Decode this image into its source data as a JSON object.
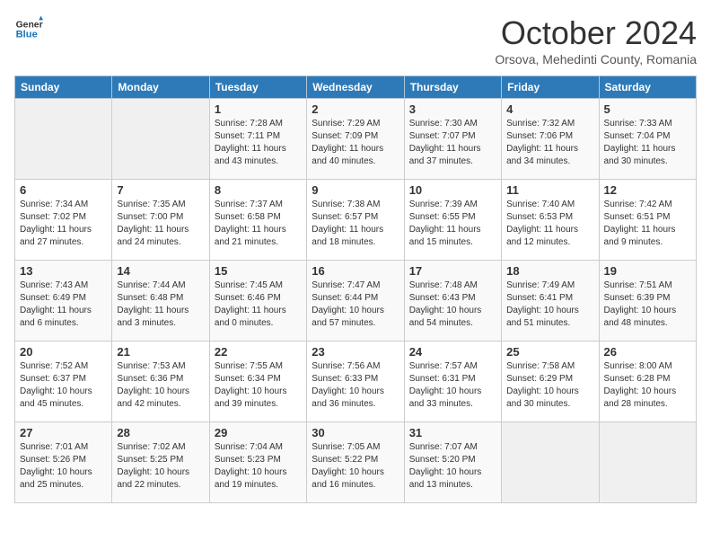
{
  "header": {
    "logo_line1": "General",
    "logo_line2": "Blue",
    "month": "October 2024",
    "location": "Orsova, Mehedinti County, Romania"
  },
  "weekdays": [
    "Sunday",
    "Monday",
    "Tuesday",
    "Wednesday",
    "Thursday",
    "Friday",
    "Saturday"
  ],
  "weeks": [
    [
      {
        "day": "",
        "info": ""
      },
      {
        "day": "",
        "info": ""
      },
      {
        "day": "1",
        "info": "Sunrise: 7:28 AM\nSunset: 7:11 PM\nDaylight: 11 hours and 43 minutes."
      },
      {
        "day": "2",
        "info": "Sunrise: 7:29 AM\nSunset: 7:09 PM\nDaylight: 11 hours and 40 minutes."
      },
      {
        "day": "3",
        "info": "Sunrise: 7:30 AM\nSunset: 7:07 PM\nDaylight: 11 hours and 37 minutes."
      },
      {
        "day": "4",
        "info": "Sunrise: 7:32 AM\nSunset: 7:06 PM\nDaylight: 11 hours and 34 minutes."
      },
      {
        "day": "5",
        "info": "Sunrise: 7:33 AM\nSunset: 7:04 PM\nDaylight: 11 hours and 30 minutes."
      }
    ],
    [
      {
        "day": "6",
        "info": "Sunrise: 7:34 AM\nSunset: 7:02 PM\nDaylight: 11 hours and 27 minutes."
      },
      {
        "day": "7",
        "info": "Sunrise: 7:35 AM\nSunset: 7:00 PM\nDaylight: 11 hours and 24 minutes."
      },
      {
        "day": "8",
        "info": "Sunrise: 7:37 AM\nSunset: 6:58 PM\nDaylight: 11 hours and 21 minutes."
      },
      {
        "day": "9",
        "info": "Sunrise: 7:38 AM\nSunset: 6:57 PM\nDaylight: 11 hours and 18 minutes."
      },
      {
        "day": "10",
        "info": "Sunrise: 7:39 AM\nSunset: 6:55 PM\nDaylight: 11 hours and 15 minutes."
      },
      {
        "day": "11",
        "info": "Sunrise: 7:40 AM\nSunset: 6:53 PM\nDaylight: 11 hours and 12 minutes."
      },
      {
        "day": "12",
        "info": "Sunrise: 7:42 AM\nSunset: 6:51 PM\nDaylight: 11 hours and 9 minutes."
      }
    ],
    [
      {
        "day": "13",
        "info": "Sunrise: 7:43 AM\nSunset: 6:49 PM\nDaylight: 11 hours and 6 minutes."
      },
      {
        "day": "14",
        "info": "Sunrise: 7:44 AM\nSunset: 6:48 PM\nDaylight: 11 hours and 3 minutes."
      },
      {
        "day": "15",
        "info": "Sunrise: 7:45 AM\nSunset: 6:46 PM\nDaylight: 11 hours and 0 minutes."
      },
      {
        "day": "16",
        "info": "Sunrise: 7:47 AM\nSunset: 6:44 PM\nDaylight: 10 hours and 57 minutes."
      },
      {
        "day": "17",
        "info": "Sunrise: 7:48 AM\nSunset: 6:43 PM\nDaylight: 10 hours and 54 minutes."
      },
      {
        "day": "18",
        "info": "Sunrise: 7:49 AM\nSunset: 6:41 PM\nDaylight: 10 hours and 51 minutes."
      },
      {
        "day": "19",
        "info": "Sunrise: 7:51 AM\nSunset: 6:39 PM\nDaylight: 10 hours and 48 minutes."
      }
    ],
    [
      {
        "day": "20",
        "info": "Sunrise: 7:52 AM\nSunset: 6:37 PM\nDaylight: 10 hours and 45 minutes."
      },
      {
        "day": "21",
        "info": "Sunrise: 7:53 AM\nSunset: 6:36 PM\nDaylight: 10 hours and 42 minutes."
      },
      {
        "day": "22",
        "info": "Sunrise: 7:55 AM\nSunset: 6:34 PM\nDaylight: 10 hours and 39 minutes."
      },
      {
        "day": "23",
        "info": "Sunrise: 7:56 AM\nSunset: 6:33 PM\nDaylight: 10 hours and 36 minutes."
      },
      {
        "day": "24",
        "info": "Sunrise: 7:57 AM\nSunset: 6:31 PM\nDaylight: 10 hours and 33 minutes."
      },
      {
        "day": "25",
        "info": "Sunrise: 7:58 AM\nSunset: 6:29 PM\nDaylight: 10 hours and 30 minutes."
      },
      {
        "day": "26",
        "info": "Sunrise: 8:00 AM\nSunset: 6:28 PM\nDaylight: 10 hours and 28 minutes."
      }
    ],
    [
      {
        "day": "27",
        "info": "Sunrise: 7:01 AM\nSunset: 5:26 PM\nDaylight: 10 hours and 25 minutes."
      },
      {
        "day": "28",
        "info": "Sunrise: 7:02 AM\nSunset: 5:25 PM\nDaylight: 10 hours and 22 minutes."
      },
      {
        "day": "29",
        "info": "Sunrise: 7:04 AM\nSunset: 5:23 PM\nDaylight: 10 hours and 19 minutes."
      },
      {
        "day": "30",
        "info": "Sunrise: 7:05 AM\nSunset: 5:22 PM\nDaylight: 10 hours and 16 minutes."
      },
      {
        "day": "31",
        "info": "Sunrise: 7:07 AM\nSunset: 5:20 PM\nDaylight: 10 hours and 13 minutes."
      },
      {
        "day": "",
        "info": ""
      },
      {
        "day": "",
        "info": ""
      }
    ]
  ]
}
